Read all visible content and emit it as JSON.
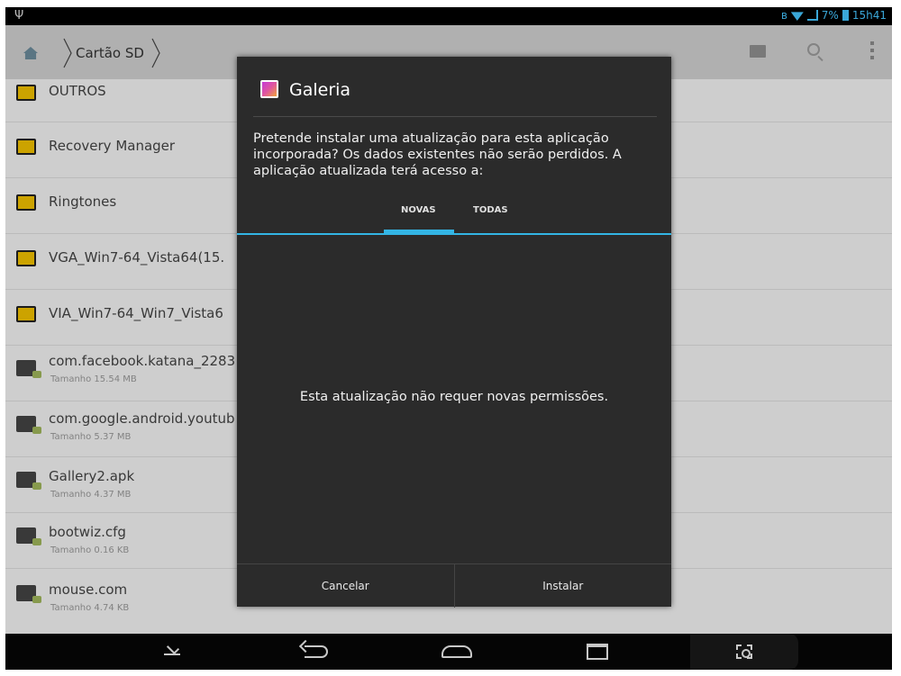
{
  "status_bar": {
    "battery_percent": "7%",
    "time": "15h41",
    "icons": [
      "usb-icon",
      "bluetooth-icon",
      "wifi-icon",
      "signal-icon",
      "battery-icon"
    ]
  },
  "action_bar": {
    "breadcrumb": "Cartão SD",
    "icons": [
      "home-icon",
      "new-folder-icon",
      "search-icon",
      "overflow-menu-icon"
    ]
  },
  "file_list": [
    {
      "name": "OUTROS",
      "type": "folder",
      "size": ""
    },
    {
      "name": "Recovery Manager",
      "type": "folder",
      "size": ""
    },
    {
      "name": "Ringtones",
      "type": "folder",
      "size": ""
    },
    {
      "name": "VGA_Win7-64_Vista64(15.",
      "type": "folder",
      "size": ""
    },
    {
      "name": "VIA_Win7-64_Win7_Vista6",
      "type": "folder",
      "size": ""
    },
    {
      "name": "com.facebook.katana_2283",
      "type": "apk",
      "size": "Tamanho 15.54 MB"
    },
    {
      "name": "com.google.android.youtub",
      "type": "apk",
      "size": "Tamanho 5.37 MB"
    },
    {
      "name": "Gallery2.apk",
      "type": "apk",
      "size": "Tamanho 4.37 MB"
    },
    {
      "name": "bootwiz.cfg",
      "type": "file",
      "size": "Tamanho 0.16 KB"
    },
    {
      "name": "mouse.com",
      "type": "file",
      "size": "Tamanho 4.74 KB"
    }
  ],
  "dialog": {
    "title": "Galeria",
    "message": "Pretende instalar uma atualização para esta aplicação incorporada? Os dados existentes não serão perdidos. A aplicação atualizada terá acesso a:",
    "tabs": [
      {
        "label": "NOVAS",
        "selected": true
      },
      {
        "label": "TODAS",
        "selected": false
      }
    ],
    "no_permissions_text": "Esta atualização não requer novas permissões.",
    "cancel_label": "Cancelar",
    "install_label": "Instalar",
    "accent_color": "#33b5e5"
  },
  "nav_bar": {
    "icons": [
      "hide-keyboard-icon",
      "back-icon",
      "home-icon",
      "recent-apps-icon",
      "screenshot-icon"
    ]
  }
}
